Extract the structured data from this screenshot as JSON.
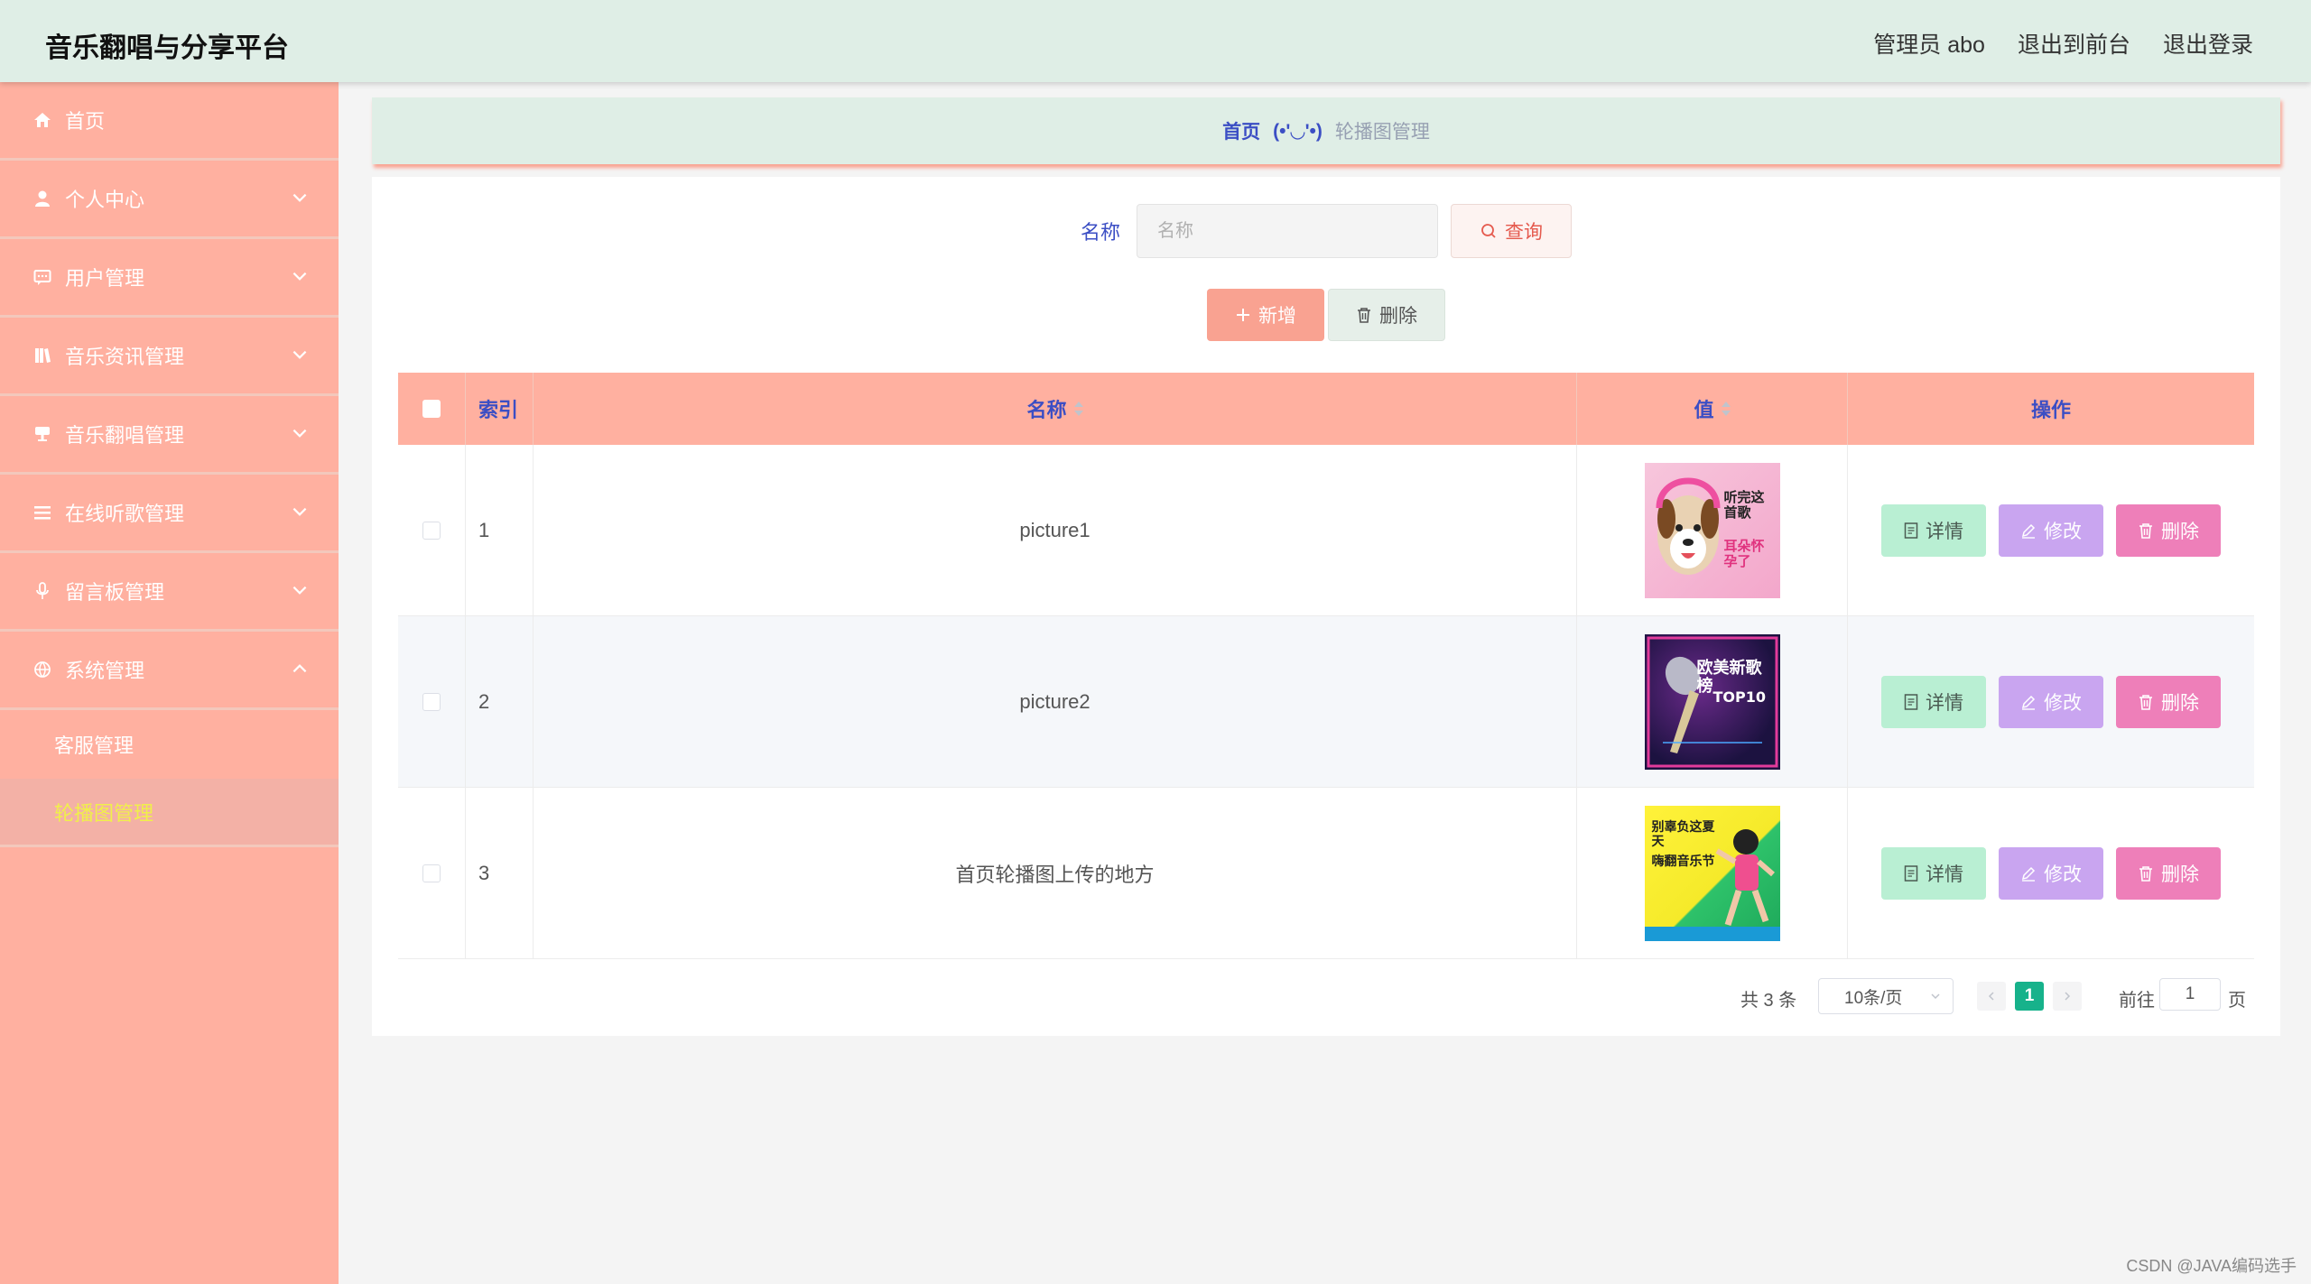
{
  "header": {
    "title": "音乐翻唱与分享平台",
    "admin": "管理员 abo",
    "to_front": "退出到前台",
    "logout": "退出登录"
  },
  "sidebar": {
    "items": [
      {
        "label": "首页",
        "icon": "home-icon"
      },
      {
        "label": "个人中心",
        "icon": "user-icon"
      },
      {
        "label": "用户管理",
        "icon": "chat-icon"
      },
      {
        "label": "音乐资讯管理",
        "icon": "book-icon"
      },
      {
        "label": "音乐翻唱管理",
        "icon": "mic-stand-icon"
      },
      {
        "label": "在线听歌管理",
        "icon": "list-icon"
      },
      {
        "label": "留言板管理",
        "icon": "microphone-icon"
      },
      {
        "label": "系统管理",
        "icon": "globe-icon"
      }
    ],
    "sub_items": [
      {
        "label": "客服管理"
      },
      {
        "label": "轮播图管理"
      }
    ]
  },
  "breadcrumb": {
    "home": "首页",
    "separator": "(•'◡'•)",
    "current": "轮播图管理"
  },
  "search": {
    "label": "名称",
    "placeholder": "名称",
    "button": "查询"
  },
  "actions": {
    "add": "新增",
    "delete": "删除"
  },
  "table": {
    "headers": {
      "index": "索引",
      "name": "名称",
      "value": "值",
      "ops": "操作"
    },
    "rows": [
      {
        "index": "1",
        "name": "picture1",
        "thumb_text_a": "听完这首歌",
        "thumb_text_b": "耳朵怀孕了"
      },
      {
        "index": "2",
        "name": "picture2",
        "thumb_text_a": "欧美新歌榜",
        "thumb_text_b": "TOP10"
      },
      {
        "index": "3",
        "name": "首页轮播图上传的地方",
        "thumb_text_a": "别辜负这夏天",
        "thumb_text_b": "嗨翻音乐节"
      }
    ],
    "ops": {
      "detail": "详情",
      "edit": "修改",
      "delete": "删除"
    }
  },
  "pagination": {
    "total": "共 3 条",
    "page_size": "10条/页",
    "current_page": "1",
    "goto_label": "前往",
    "goto_value": "1",
    "page_suffix": "页"
  },
  "watermark": "CSDN @JAVA编码选手",
  "colors": {
    "header_bg": "#dfeee6",
    "sidebar_bg": "#ffb0a0",
    "accent_text": "#3b4ec4",
    "active_sub_text": "#f0f04a",
    "pager_active": "#17b28b"
  }
}
